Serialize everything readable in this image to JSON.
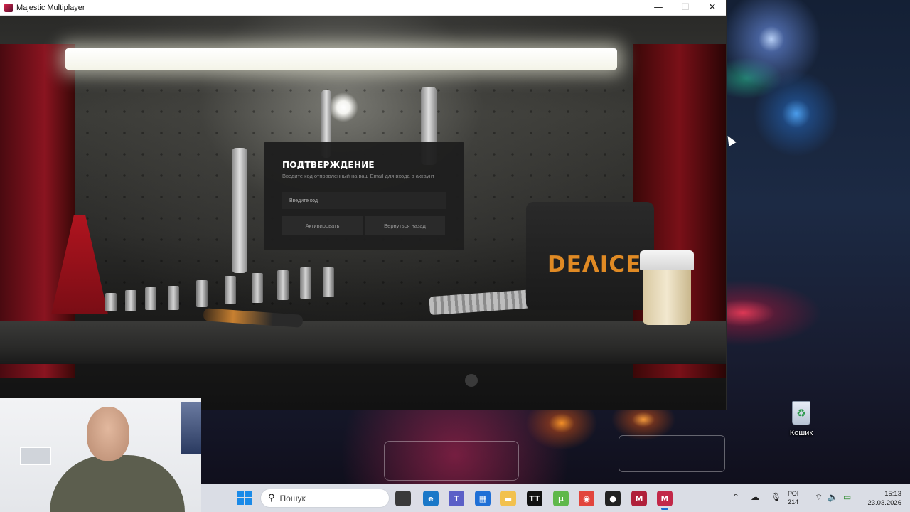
{
  "window": {
    "title": "Majestic Multiplayer",
    "minimize_glyph": "—",
    "maximize_glyph": "☐",
    "close_glyph": "✕"
  },
  "modal": {
    "title": "ПОДТВЕРЖДЕНИЕ",
    "subtitle": "Введите код отправленный на ваш Email для входа в аккаунт",
    "input_placeholder": "Введите код",
    "input_value": "",
    "activate_label": "Активировать",
    "back_label": "Вернуться назад"
  },
  "scene": {
    "case_logo": "DEΛICE"
  },
  "desktop": {
    "recycle_bin_label": "Кошик",
    "recycle_bin_glyph": "♻"
  },
  "taskbar": {
    "search_placeholder": "Пошук",
    "search_glyph": "⚲",
    "apps": [
      {
        "name": "file-manager-icon",
        "label": "",
        "color": "#3a3a3a"
      },
      {
        "name": "edge-icon",
        "label": "e",
        "color": "#1a78c8"
      },
      {
        "name": "teams-icon",
        "label": "T",
        "color": "#5b5fc7"
      },
      {
        "name": "store-icon",
        "label": "▦",
        "color": "#1f6fd6"
      },
      {
        "name": "explorer-icon",
        "label": "▬",
        "color": "#f2c14e"
      },
      {
        "name": "tiktok-icon",
        "label": "TT",
        "color": "#111111"
      },
      {
        "name": "utorrent-icon",
        "label": "µ",
        "color": "#5fb84a"
      },
      {
        "name": "chrome-icon",
        "label": "◉",
        "color": "#e2453c"
      },
      {
        "name": "obs-icon",
        "label": "●",
        "color": "#222222"
      },
      {
        "name": "game-app-icon",
        "label": "M",
        "color": "#b0203a"
      },
      {
        "name": "majestic-icon",
        "label": "M",
        "color": "#c22848"
      }
    ],
    "language_top": "РОІ",
    "language_bottom": "214",
    "time": "15:13",
    "date": "23.03.2026"
  }
}
